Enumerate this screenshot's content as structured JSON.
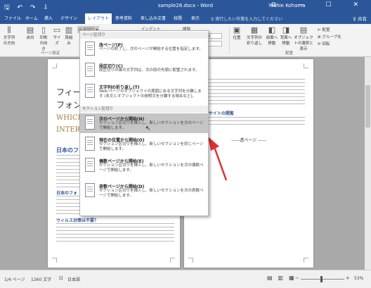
{
  "titlebar": {
    "quick_access": "🖫 ↶ ↷ ⇩",
    "title": "sample28.docx - Word",
    "user": "Yoshie Kohama",
    "controls": "⧉ — ☐ ✕"
  },
  "tabs": [
    {
      "label": "ファイル"
    },
    {
      "label": "ホーム"
    },
    {
      "label": "挿入"
    },
    {
      "label": "デザイン"
    },
    {
      "label": "レイアウト"
    },
    {
      "label": "参考資料"
    },
    {
      "label": "差し込み文書"
    },
    {
      "label": "校閲"
    },
    {
      "label": "表示"
    }
  ],
  "tell_me": "♀ 実行したい作業を入力してください",
  "share": "♀ 共有",
  "ribbon": {
    "text_direction": "文字列の方向",
    "margins": "余白",
    "orientation": "印刷の向き",
    "size": "サイズ",
    "columns": "段組み",
    "breaks_dropdown": "区切り",
    "indent_label": "インデント",
    "spacing_label": "間隔",
    "spacing_before": "20 pt",
    "spacing_after": "3 pt",
    "group_page_setup": "ページ設定",
    "position": "位置",
    "wrap_text": "文字列の折り返し",
    "bring_forward": "前面へ移動",
    "send_backward": "背面へ移動",
    "selection_pane": "オブジェクトの選択と表示",
    "align": "配置",
    "group": "グループ化",
    "rotate": "回転",
    "group_arrange": "配置"
  },
  "menu": {
    "header_page": "ページ区切り",
    "header_section": "セクション区切り",
    "items": [
      {
        "title": "改ページ(P)",
        "desc": "ページの終了し、次のページが開始する位置を指定します。"
      },
      {
        "title": "段区切り(C)",
        "desc": "段区切りの後の文字列は、次の段の先頭に配置されます。"
      },
      {
        "title": "文字列の折り返し(T)",
        "desc": "Web ページのオブジェクトの周囲にある文字列を分離します (本文とオブジェクトの説明文を分離する場合など)。"
      },
      {
        "title": "次のページから開始(N)",
        "desc": "セクション区切りを挿入し、新しいセクションを次のページで開始します。"
      },
      {
        "title": "現在の位置から開始(O)",
        "desc": "セクション区切りを挿入し、新しいセクションを同じページで開始します。"
      },
      {
        "title": "偶数ページから開始(E)",
        "desc": "セクション区切りを挿入し、新しいセクションを次の偶数ページで開始します。"
      },
      {
        "title": "奇数ページから開始(D)",
        "desc": "セクション区切りを挿入し、新しいセクションを次の奇数ページで開始します。"
      }
    ]
  },
  "page_left": {
    "title_line1": "フィー",
    "title_line2": "フォン",
    "title_en1": "WHICE",
    "title_en2": "INTER",
    "heading": "日本のフ",
    "heading2": "日本のフォ",
    "heading3": "ウィルス対策は不要？"
  },
  "page_right": {
    "heading": "PC 用のサイトの閲覧",
    "center_text": "——透ページ ——"
  },
  "status": {
    "page": "1/4 ページ",
    "words": "1260 文字",
    "lang": "日本語",
    "zoom": "53%"
  },
  "colors": {
    "accent": "#2b579a",
    "title_gold": "#9b7c3c",
    "heading_blue": "#2f5496",
    "arrow_red": "#e03030",
    "menu_hover": "#c5c5c5"
  }
}
